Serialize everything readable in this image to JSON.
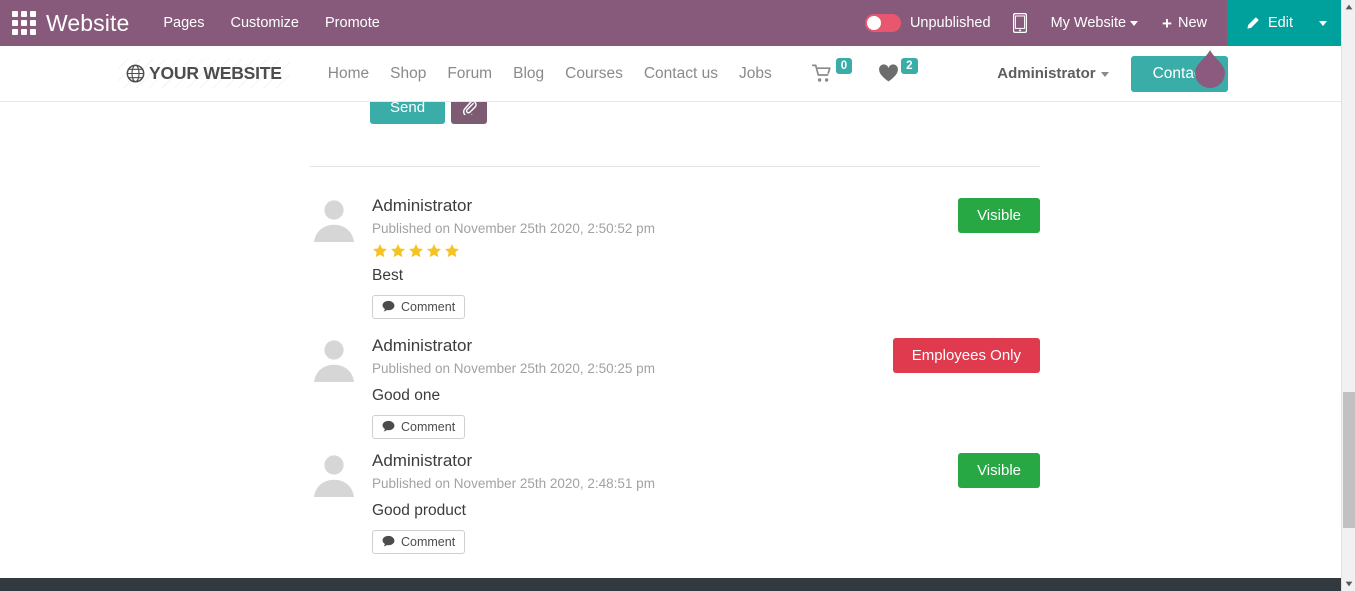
{
  "topbar": {
    "apps_icon": "apps-grid-icon",
    "app_title": "Website",
    "menu": [
      {
        "label": "Pages"
      },
      {
        "label": "Customize"
      },
      {
        "label": "Promote"
      }
    ],
    "publish_toggle_state": "off",
    "publish_label": "Unpublished",
    "mobile_preview_icon": "mobile-preview-icon",
    "site_selector": "My Website",
    "new_label": "New",
    "new_icon": "plus-icon",
    "edit_label": "Edit",
    "edit_icon": "pencil-icon",
    "bar_color": "#875a7b",
    "edit_color": "#00a09d"
  },
  "site_header": {
    "logo_icon": "globe-icon",
    "brand": "YOUR WEBSITE",
    "nav": [
      {
        "label": "Home"
      },
      {
        "label": "Shop"
      },
      {
        "label": "Forum"
      },
      {
        "label": "Blog"
      },
      {
        "label": "Courses"
      },
      {
        "label": "Contact us"
      },
      {
        "label": "Jobs"
      }
    ],
    "cart_icon": "shopping-cart-icon",
    "cart_count": "0",
    "wishlist_icon": "heart-icon",
    "wishlist_count": "2",
    "badge_color": "#3aada8",
    "user_menu": "Administrator",
    "contact_button": "Contact"
  },
  "composer": {
    "send_label": "Send",
    "attach_icon": "paperclip-icon"
  },
  "reviews": [
    {
      "author": "Administrator",
      "date": "Published on November 25th 2020, 2:50:52 pm",
      "rating": 5,
      "text": "Best",
      "comment_label": "Comment",
      "comment_icon": "comment-bubble-icon",
      "status_label": "Visible",
      "status_color": "#28a745"
    },
    {
      "author": "Administrator",
      "date": "Published on November 25th 2020, 2:50:25 pm",
      "rating": 0,
      "text": "Good one",
      "comment_label": "Comment",
      "comment_icon": "comment-bubble-icon",
      "status_label": "Employees Only",
      "status_color": "#e03a4e"
    },
    {
      "author": "Administrator",
      "date": "Published on November 25th 2020, 2:48:51 pm",
      "rating": 0,
      "text": "Good product",
      "comment_label": "Comment",
      "comment_icon": "comment-bubble-icon",
      "status_label": "Visible",
      "status_color": "#28a745"
    }
  ],
  "footer": {
    "color": "#32393f"
  },
  "marker": {
    "shape": "teardrop-pin",
    "color": "#8c5a7e"
  },
  "scrollbar": {
    "track_color": "#f1f1f1",
    "thumb_color": "#c1c1c1"
  },
  "star_color": "#f6c324"
}
